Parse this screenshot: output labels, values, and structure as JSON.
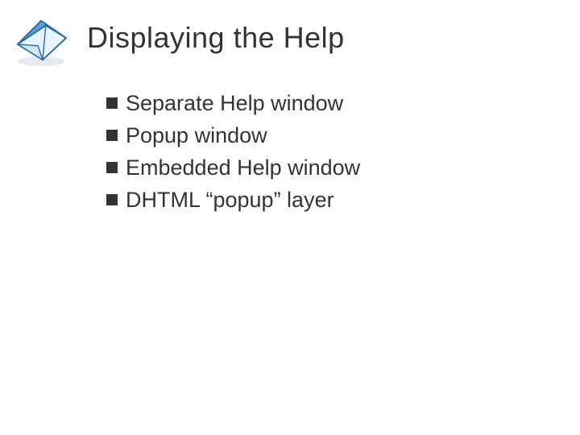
{
  "slide": {
    "title": "Displaying the Help",
    "bullets": [
      "Separate Help window",
      "Popup window",
      "Embedded Help window",
      "DHTML “popup” layer"
    ]
  },
  "icon": {
    "name": "logo-folded-paper"
  }
}
